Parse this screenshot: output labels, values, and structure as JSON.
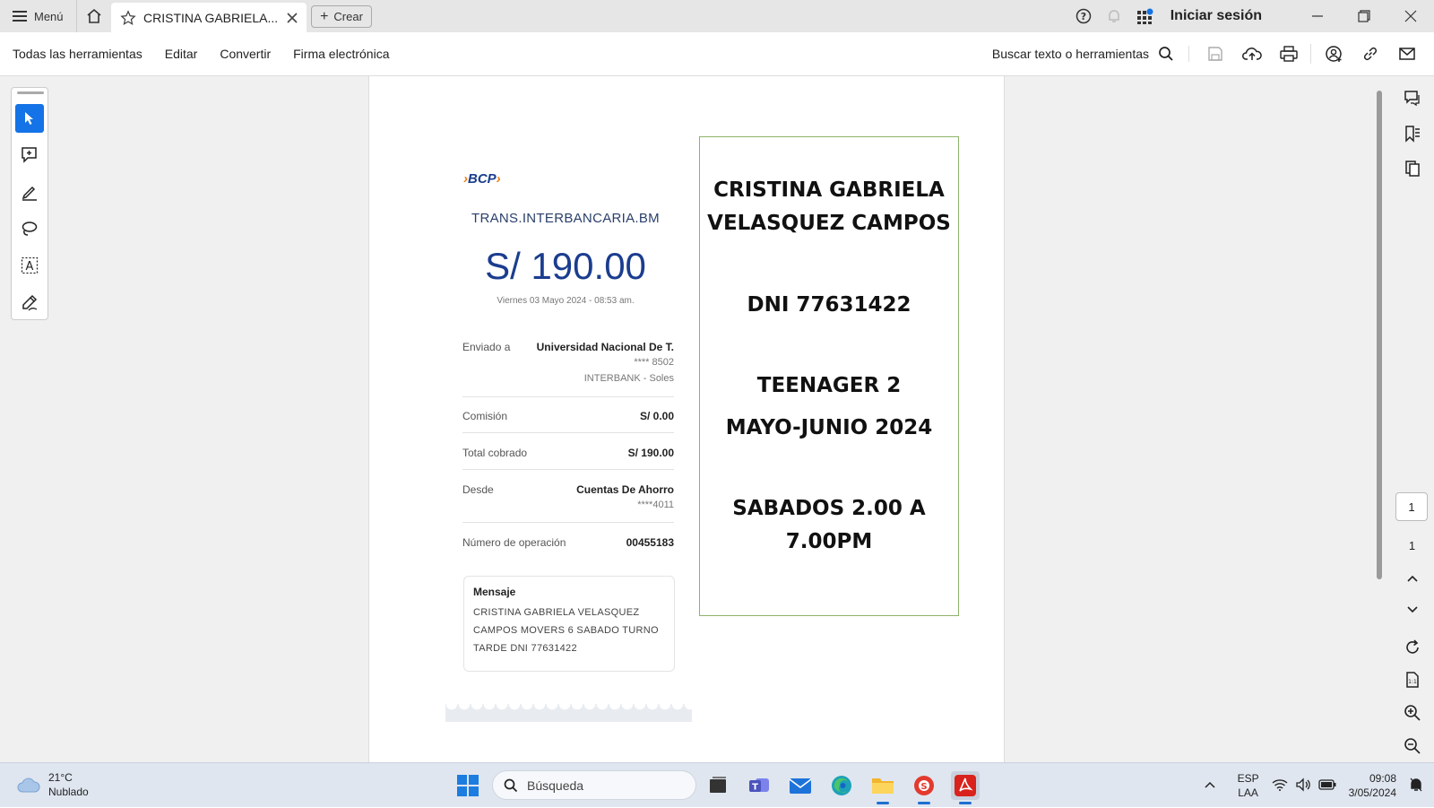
{
  "titlebar": {
    "menu_label": "Menú",
    "tab_label": "CRISTINA GABRIELA...",
    "create_label": "Crear",
    "signin_label": "Iniciar sesión"
  },
  "toolbar": {
    "items": [
      "Todas las herramientas",
      "Editar",
      "Convertir",
      "Firma electrónica"
    ],
    "search_label": "Buscar texto o herramientas"
  },
  "receipt": {
    "logo": "BCP",
    "title": "TRANS.INTERBANCARIA.BM",
    "amount": "S/ 190.00",
    "date": "Viernes 03 Mayo 2024 - 08:53 am.",
    "sent_to_label": "Enviado a",
    "sent_to_name": "Universidad Nacional De T.",
    "sent_to_account": "**** 8502",
    "sent_to_bank": "INTERBANK - Soles",
    "commission_label": "Comisión",
    "commission_value": "S/ 0.00",
    "total_label": "Total cobrado",
    "total_value": "S/ 190.00",
    "from_label": "Desde",
    "from_value": "Cuentas De Ahorro",
    "from_account": "****4011",
    "operation_label": "Número de operación",
    "operation_value": "00455183",
    "message_title": "Mensaje",
    "message_body": "CRISTINA GABRIELA VELASQUEZ CAMPOS  MOVERS 6  SABADO TURNO TARDE   DNI 77631422"
  },
  "card": {
    "name_line1": "CRISTINA GABRIELA",
    "name_line2": "VELASQUEZ CAMPOS",
    "dni": "DNI 77631422",
    "course": "TEENAGER 2",
    "period": "MAYO-JUNIO 2024",
    "schedule_line1": "SABADOS 2.00 A",
    "schedule_line2": "7.00PM"
  },
  "pager": {
    "current": "1",
    "total": "1"
  },
  "taskbar": {
    "weather_temp": "21°C",
    "weather_desc": "Nublado",
    "search_placeholder": "Búsqueda",
    "lang_line1": "ESP",
    "lang_line2": "LAA",
    "time": "09:08",
    "date": "3/05/2024"
  },
  "colors": {
    "accent": "#1473e6",
    "bcp_blue": "#1b3d8f",
    "card_border": "#8db36a"
  }
}
